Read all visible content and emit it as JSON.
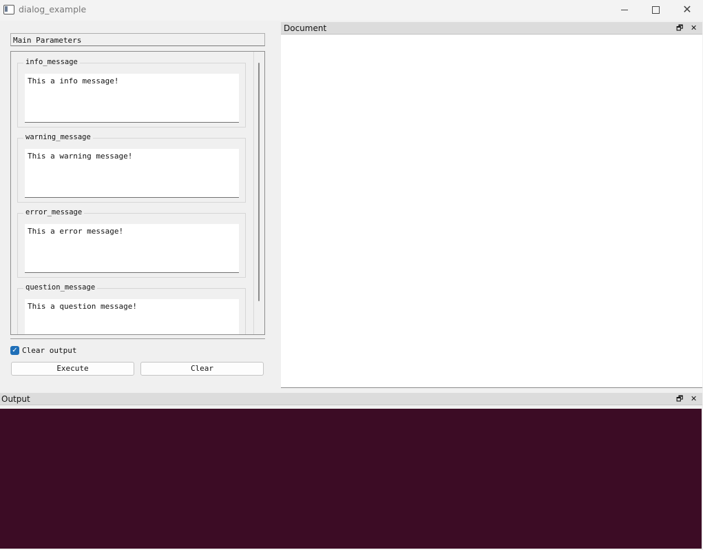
{
  "window": {
    "title": "dialog_example",
    "minimize_icon": "minimize-icon",
    "maximize_icon": "maximize-icon",
    "close_glyph": "✕"
  },
  "params": {
    "header": "Main Parameters",
    "groups": [
      {
        "label": "info_message",
        "value": "This a info message!"
      },
      {
        "label": "warning_message",
        "value": "This a warning message!"
      },
      {
        "label": "error_message",
        "value": "This a error message!"
      },
      {
        "label": "question_message",
        "value": "This a question message!"
      }
    ]
  },
  "controls": {
    "clear_output_label": "Clear output",
    "clear_output_checked": true,
    "checkmark": "✓",
    "execute_label": "Execute",
    "clear_label": "Clear"
  },
  "document_dock": {
    "title": "Document",
    "float_glyph": "🗗",
    "close_glyph": "✕"
  },
  "output_dock": {
    "title": "Output",
    "float_glyph": "🗗",
    "close_glyph": "✕",
    "background": "#3c0c25"
  }
}
